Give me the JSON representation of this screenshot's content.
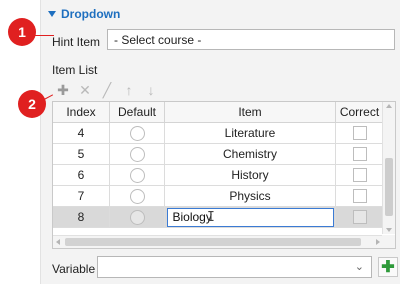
{
  "section": {
    "title": "Dropdown"
  },
  "hint": {
    "label": "Hint Item",
    "value": "- Select course -"
  },
  "item_list": {
    "label": "Item List",
    "toolbar": [
      {
        "name": "add-item",
        "icon": "plus-icon",
        "glyph": "✚",
        "enabled": true
      },
      {
        "name": "delete-item",
        "icon": "close-icon",
        "glyph": "✕",
        "enabled": false
      },
      {
        "name": "edit-item",
        "icon": "pencil-icon",
        "glyph": "╱",
        "enabled": false
      },
      {
        "name": "move-up",
        "icon": "arrow-up-icon",
        "glyph": "↑",
        "enabled": false
      },
      {
        "name": "move-down",
        "icon": "arrow-down-icon",
        "glyph": "↓",
        "enabled": false
      }
    ],
    "columns": [
      "Index",
      "Default",
      "Item",
      "Correct"
    ],
    "rows": [
      {
        "index": "4",
        "item": "Literature"
      },
      {
        "index": "5",
        "item": "Chemistry"
      },
      {
        "index": "6",
        "item": "History"
      },
      {
        "index": "7",
        "item": "Physics"
      },
      {
        "index": "8",
        "item": "Biology",
        "editing": true
      }
    ]
  },
  "variable": {
    "label": "Variable",
    "value": ""
  },
  "callouts": [
    "1",
    "2"
  ],
  "colors": {
    "accent": "#1e6fbf",
    "callout": "#e02020",
    "add": "#2e9a3a"
  }
}
